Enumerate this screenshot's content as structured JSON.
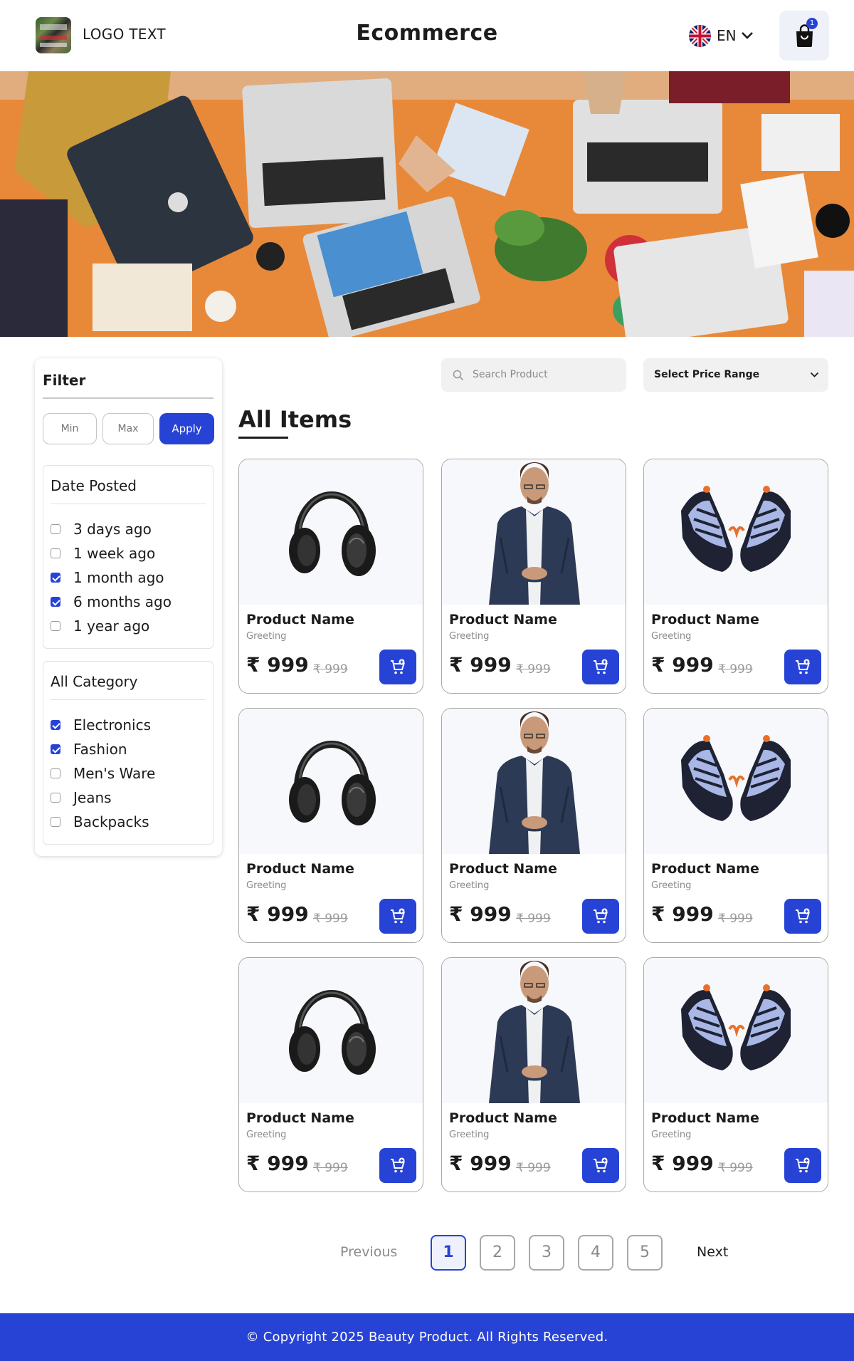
{
  "header": {
    "logo_text": "LOGO TEXT",
    "brand": "Ecommerce",
    "language": "EN",
    "cart_count": "1"
  },
  "filter": {
    "title": "Filter",
    "min_placeholder": "Min",
    "max_placeholder": "Max",
    "apply_label": "Apply"
  },
  "date_posted": {
    "title": "Date Posted",
    "options": [
      {
        "label": "3 days ago",
        "checked": false
      },
      {
        "label": "1 week ago",
        "checked": false
      },
      {
        "label": "1 month ago",
        "checked": true
      },
      {
        "label": "6 months ago",
        "checked": true
      },
      {
        "label": "1 year ago",
        "checked": false
      }
    ]
  },
  "category": {
    "title": "All Category",
    "options": [
      {
        "label": "Electronics",
        "checked": true
      },
      {
        "label": "Fashion",
        "checked": true
      },
      {
        "label": "Men's Ware",
        "checked": false
      },
      {
        "label": "Jeans",
        "checked": false
      },
      {
        "label": "Backpacks",
        "checked": false
      }
    ]
  },
  "search": {
    "placeholder": "Search Product"
  },
  "price_select": {
    "label": "Select Price Range"
  },
  "section_title": "All Items",
  "products": [
    {
      "name": "Product Name",
      "subtitle": "Greeting",
      "price": "₹ 999",
      "old_price": "₹ 999",
      "image": "headphones"
    },
    {
      "name": "Product Name",
      "subtitle": "Greeting",
      "price": "₹ 999",
      "old_price": "₹ 999",
      "image": "man-shirt"
    },
    {
      "name": "Product Name",
      "subtitle": "Greeting",
      "price": "₹ 999",
      "old_price": "₹ 999",
      "image": "sneakers"
    },
    {
      "name": "Product Name",
      "subtitle": "Greeting",
      "price": "₹ 999",
      "old_price": "₹ 999",
      "image": "headphones"
    },
    {
      "name": "Product Name",
      "subtitle": "Greeting",
      "price": "₹ 999",
      "old_price": "₹ 999",
      "image": "man-shirt"
    },
    {
      "name": "Product Name",
      "subtitle": "Greeting",
      "price": "₹ 999",
      "old_price": "₹ 999",
      "image": "sneakers"
    },
    {
      "name": "Product Name",
      "subtitle": "Greeting",
      "price": "₹ 999",
      "old_price": "₹ 999",
      "image": "headphones"
    },
    {
      "name": "Product Name",
      "subtitle": "Greeting",
      "price": "₹ 999",
      "old_price": "₹ 999",
      "image": "man-shirt"
    },
    {
      "name": "Product Name",
      "subtitle": "Greeting",
      "price": "₹ 999",
      "old_price": "₹ 999",
      "image": "sneakers"
    }
  ],
  "pagination": {
    "previous": "Previous",
    "next": "Next",
    "pages": [
      "1",
      "2",
      "3",
      "4",
      "5"
    ],
    "active": "1"
  },
  "footer": {
    "copyright": "© Copyright 2025 Beauty Product. All Rights Reserved."
  },
  "colors": {
    "accent": "#2743d6",
    "muted": "#8a8a8a",
    "border": "#a8a8a8"
  },
  "icons": [
    "logo-image",
    "uk-flag-icon",
    "chevron-down-icon",
    "shopping-bag-icon",
    "search-icon",
    "add-to-cart-icon"
  ]
}
